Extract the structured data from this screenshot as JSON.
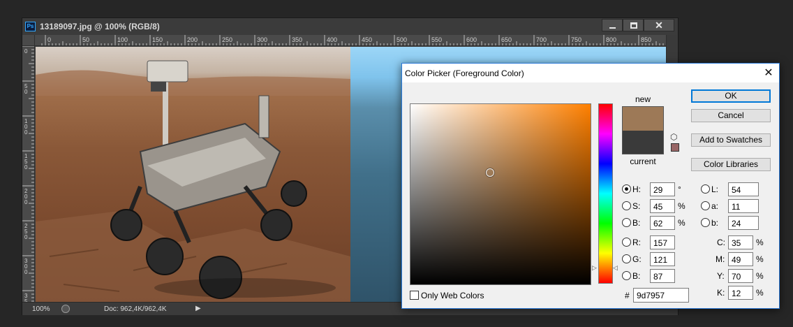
{
  "document": {
    "title": "13189097.jpg @ 100% (RGB/8)",
    "app_badge": "Ps",
    "zoom": "100%",
    "doc_size": "Doc: 962,4K/962,4K",
    "ruler_h_ticks": [
      "0",
      "50",
      "100",
      "150",
      "200",
      "250",
      "300",
      "350",
      "400",
      "450",
      "500",
      "550",
      "600",
      "650",
      "700",
      "750",
      "800",
      "850"
    ],
    "ruler_v_ticks": [
      "0",
      "50",
      "100",
      "150",
      "200",
      "250",
      "300",
      "350"
    ]
  },
  "dialog": {
    "title": "Color Picker (Foreground Color)",
    "close_glyph": "✕",
    "new_label": "new",
    "current_label": "current",
    "new_color": "#9d7957",
    "current_color": "#3a3a3a",
    "websafe_color": "#996666",
    "hue_color": "#ff8000",
    "buttons": {
      "ok": "OK",
      "cancel": "Cancel",
      "add_to_swatches": "Add to Swatches",
      "color_libraries": "Color Libraries"
    },
    "hsb": [
      {
        "label": "H:",
        "value": "29",
        "unit": "°",
        "selected": true
      },
      {
        "label": "S:",
        "value": "45",
        "unit": "%",
        "selected": false
      },
      {
        "label": "B:",
        "value": "62",
        "unit": "%",
        "selected": false
      }
    ],
    "rgb": [
      {
        "label": "R:",
        "value": "157"
      },
      {
        "label": "G:",
        "value": "121"
      },
      {
        "label": "B:",
        "value": "87"
      }
    ],
    "lab": [
      {
        "label": "L:",
        "value": "54"
      },
      {
        "label": "a:",
        "value": "11"
      },
      {
        "label": "b:",
        "value": "24"
      }
    ],
    "cmyk": [
      {
        "label": "C:",
        "value": "35",
        "unit": "%"
      },
      {
        "label": "M:",
        "value": "49",
        "unit": "%"
      },
      {
        "label": "Y:",
        "value": "70",
        "unit": "%"
      },
      {
        "label": "K:",
        "value": "12",
        "unit": "%"
      }
    ],
    "only_web_colors": "Only Web Colors",
    "hex_prefix": "#",
    "hex": "9d7957"
  }
}
